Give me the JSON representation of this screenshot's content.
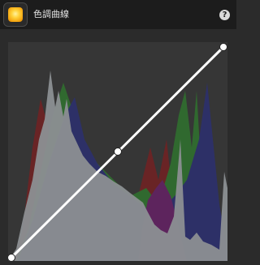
{
  "header": {
    "title": "色調曲線",
    "help_symbol": "?",
    "tool_icon": "tone-curve-tool-icon"
  },
  "curve_editor": {
    "background": "#363636",
    "line_color": "#ffffff",
    "points": [
      {
        "input": 0,
        "output": 0
      },
      {
        "input": 0.5,
        "output": 0.5
      },
      {
        "input": 1,
        "output": 1
      }
    ],
    "histogram": {
      "luminance_color": "#a9aeb2",
      "red_color": "#7a1e20",
      "green_color": "#2f7a2d",
      "blue_color": "#2a2f78",
      "magenta_color": "#6a1f6a"
    }
  }
}
